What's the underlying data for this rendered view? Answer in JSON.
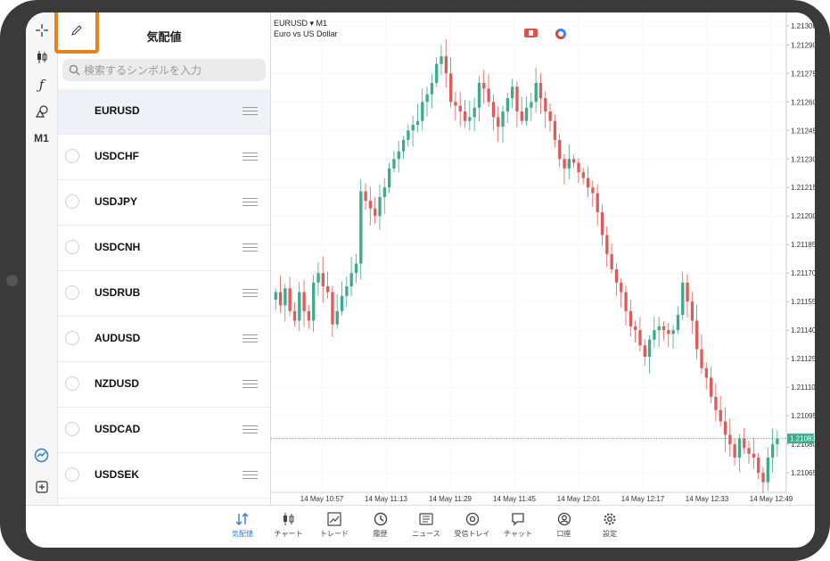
{
  "quotes_panel": {
    "title": "気配値",
    "search_placeholder": "検索するシンボルを入力",
    "symbols": [
      {
        "name": "EURUSD",
        "selected": true
      },
      {
        "name": "USDCHF",
        "selected": false
      },
      {
        "name": "USDJPY",
        "selected": false
      },
      {
        "name": "USDCNH",
        "selected": false
      },
      {
        "name": "USDRUB",
        "selected": false
      },
      {
        "name": "AUDUSD",
        "selected": false
      },
      {
        "name": "NZDUSD",
        "selected": false
      },
      {
        "name": "USDCAD",
        "selected": false
      },
      {
        "name": "USDSEK",
        "selected": false
      }
    ]
  },
  "toolbar": {
    "timeframe": "M1",
    "icons": [
      "crosshair-icon",
      "candlestick-icon",
      "indicator-f-icon",
      "objects-icon",
      "timeframe-m1",
      "trade-chart-icon",
      "new-order-icon"
    ]
  },
  "chart": {
    "symbol_line": "EURUSD ▾ M1",
    "description": "Euro vs US Dollar",
    "current_price": "1.21083"
  },
  "chart_data": {
    "type": "candlestick",
    "y_ticks": [
      "1.21300",
      "1.21290",
      "1.21275",
      "1.21260",
      "1.21245",
      "1.21230",
      "1.21215",
      "1.21200",
      "1.21185",
      "1.21170",
      "1.21155",
      "1.21140",
      "1.21125",
      "1.21110",
      "1.21095",
      "1.21080",
      "1.21065"
    ],
    "x_ticks": [
      "14 May 10:57",
      "14 May 11:13",
      "14 May 11:29",
      "14 May 11:45",
      "14 May 12:01",
      "14 May 12:17",
      "14 May 12:33",
      "14 May 12:49"
    ],
    "close_path": [
      1.2116,
      1.21153,
      1.21162,
      1.2115,
      1.21145,
      1.2116,
      1.2115,
      1.21145,
      1.21165,
      1.2117,
      1.21163,
      1.2116,
      1.21143,
      1.2115,
      1.21158,
      1.21163,
      1.2117,
      1.21175,
      1.21213,
      1.21208,
      1.21204,
      1.212,
      1.2121,
      1.21215,
      1.21225,
      1.2123,
      1.21234,
      1.2124,
      1.21245,
      1.21248,
      1.2125,
      1.2126,
      1.21264,
      1.2127,
      1.2128,
      1.21284,
      1.21275,
      1.2126,
      1.21258,
      1.21255,
      1.2125,
      1.21252,
      1.21257,
      1.2127,
      1.21267,
      1.2126,
      1.21252,
      1.21247,
      1.21255,
      1.21262,
      1.21268,
      1.21255,
      1.2125,
      1.21257,
      1.2126,
      1.2127,
      1.21262,
      1.21255,
      1.2125,
      1.2124,
      1.2123,
      1.21225,
      1.2123,
      1.21228,
      1.21223,
      1.2122,
      1.21215,
      1.21212,
      1.21202,
      1.2119,
      1.2118,
      1.21172,
      1.21165,
      1.2116,
      1.2115,
      1.21142,
      1.2114,
      1.21132,
      1.21126,
      1.21135,
      1.2114,
      1.21142,
      1.2114,
      1.21138,
      1.2114,
      1.21148,
      1.21165,
      1.21155,
      1.21145,
      1.2113,
      1.2112,
      1.21115,
      1.21105,
      1.21098,
      1.21092,
      1.21085,
      1.2108,
      1.21073,
      1.21083,
      1.21078,
      1.21075,
      1.21073,
      1.21065,
      1.2106,
      1.21073,
      1.2108,
      1.21083
    ],
    "series_colors": {
      "up": "#3daa8a",
      "down": "#e25a57"
    },
    "grid": true
  },
  "bottom_nav": [
    {
      "label": "気配値",
      "icon": "quotes-arrows-icon",
      "active": true
    },
    {
      "label": "チャート",
      "icon": "chart-candles-icon",
      "active": false
    },
    {
      "label": "トレード",
      "icon": "trade-line-icon",
      "active": false
    },
    {
      "label": "履歴",
      "icon": "history-clock-icon",
      "active": false
    },
    {
      "label": "ニュース",
      "icon": "news-icon",
      "active": false
    },
    {
      "label": "受信トレイ",
      "icon": "mail-at-icon",
      "active": false
    },
    {
      "label": "チャット",
      "icon": "chat-icon",
      "active": false
    },
    {
      "label": "口座",
      "icon": "account-icon",
      "active": false
    },
    {
      "label": "設定",
      "icon": "settings-gear-icon",
      "active": false
    }
  ]
}
